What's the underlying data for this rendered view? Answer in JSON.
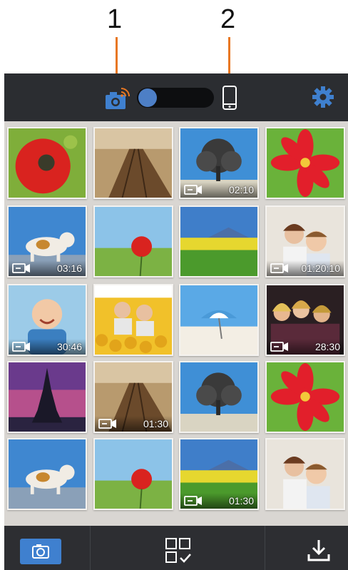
{
  "callouts": [
    {
      "label": "1"
    },
    {
      "label": "2"
    }
  ],
  "topbar": {
    "camera_icon": "wireless-camera-icon",
    "toggle_state": "camera",
    "phone_icon": "smartphone-icon",
    "settings_icon": "gear-icon"
  },
  "colors": {
    "accent": "#3f80cf",
    "callout_line": "#e87722",
    "topbar": "#2b2d31",
    "bottombar": "#1e2024"
  },
  "gallery": {
    "items": [
      {
        "subject": "poppy-flower",
        "type": "photo",
        "duration": ""
      },
      {
        "subject": "wooden-pier",
        "type": "photo",
        "duration": ""
      },
      {
        "subject": "tree",
        "type": "video",
        "duration": "02:10"
      },
      {
        "subject": "red-flower",
        "type": "photo",
        "duration": ""
      },
      {
        "subject": "puppy",
        "type": "video",
        "duration": "03:16"
      },
      {
        "subject": "poppy-field",
        "type": "photo",
        "duration": ""
      },
      {
        "subject": "meadow-mountain",
        "type": "photo",
        "duration": ""
      },
      {
        "subject": "children",
        "type": "video",
        "duration": "01:20:10"
      },
      {
        "subject": "baby",
        "type": "video",
        "duration": "30:46"
      },
      {
        "subject": "couple-sunflowers",
        "type": "photo",
        "duration": ""
      },
      {
        "subject": "beach-umbrella",
        "type": "photo",
        "duration": ""
      },
      {
        "subject": "women-group",
        "type": "video",
        "duration": "28:30"
      },
      {
        "subject": "eiffel-tower",
        "type": "photo",
        "duration": ""
      },
      {
        "subject": "wooden-pier",
        "type": "video",
        "duration": "01:30"
      },
      {
        "subject": "tree",
        "type": "photo",
        "duration": ""
      },
      {
        "subject": "red-flower",
        "type": "photo",
        "duration": ""
      },
      {
        "subject": "puppy",
        "type": "photo",
        "duration": ""
      },
      {
        "subject": "poppy-field",
        "type": "photo",
        "duration": ""
      },
      {
        "subject": "meadow-mountain",
        "type": "video",
        "duration": "01:30"
      },
      {
        "subject": "children",
        "type": "photo",
        "duration": ""
      }
    ]
  },
  "bottombar": {
    "camera_icon": "camera-icon",
    "select_icon": "grid-select-icon",
    "download_icon": "download-icon"
  }
}
